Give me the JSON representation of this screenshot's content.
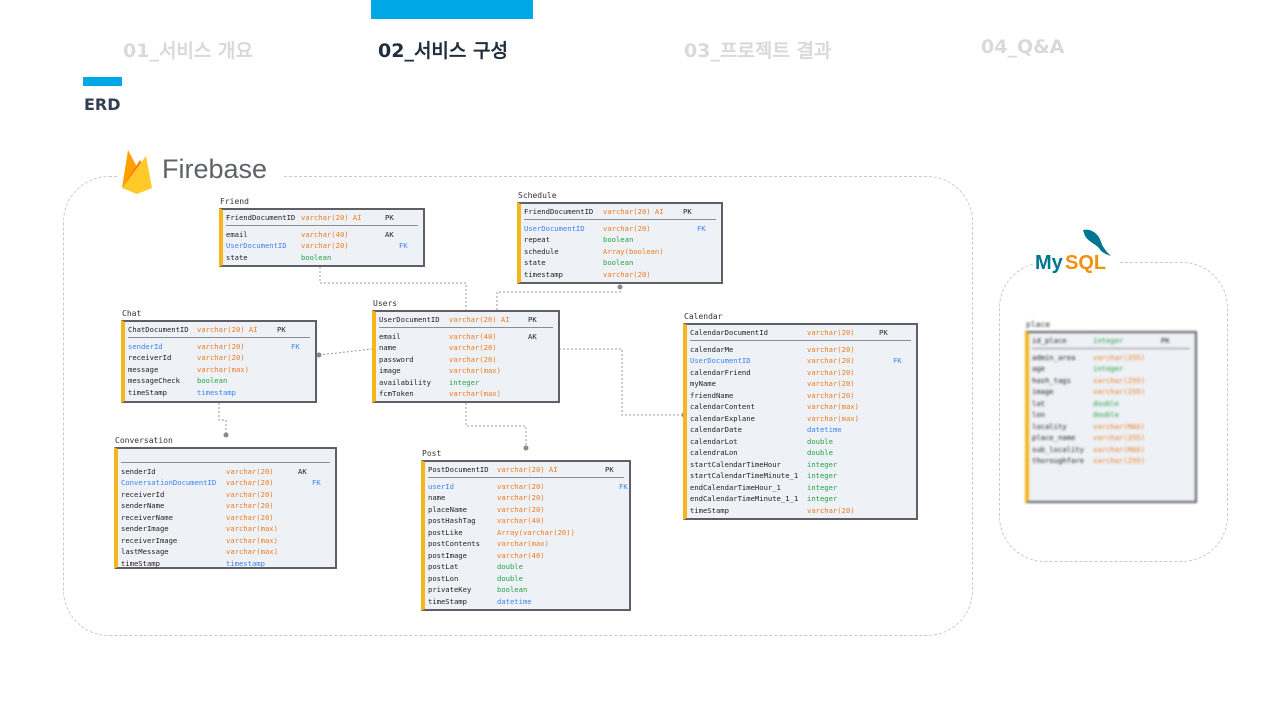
{
  "nav": {
    "tabs": [
      {
        "label": "01_서비스 개요",
        "active": false
      },
      {
        "label": "02_서비스 구성",
        "active": true
      },
      {
        "label": "03_프로젝트 결과",
        "active": false
      },
      {
        "label": "04_Q&A",
        "active": false
      }
    ]
  },
  "section": {
    "title": "ERD"
  },
  "logos": {
    "firebase": "Firebase",
    "mysql_my": "My",
    "mysql_sql": "SQL"
  },
  "colors": {
    "accent": "#00a8e8",
    "table_stripe": "#f5b51c",
    "varchar": "#ec7c22",
    "numeric": "#22a346",
    "fk": "#3b82f6"
  },
  "tables": [
    {
      "id": "friend",
      "name": "Friend",
      "header": [
        {
          "col": "FriendDocumentID",
          "type": "varchar(20) AI",
          "key": "PK"
        }
      ],
      "rows": [
        {
          "col": "email",
          "type": "varchar(40)",
          "key": "AK"
        },
        {
          "col": "UserDocumentID",
          "type": "varchar(20)",
          "key": "FK"
        },
        {
          "col": "state",
          "type": "boolean",
          "key": ""
        }
      ]
    },
    {
      "id": "schedule",
      "name": "Schedule",
      "header": [
        {
          "col": "FriendDocumentID",
          "type": "varchar(20) AI",
          "key": "PK"
        }
      ],
      "rows": [
        {
          "col": "UserDocumentID",
          "type": "varchar(20)",
          "key": "FK"
        },
        {
          "col": "repeat",
          "type": "boolean",
          "key": ""
        },
        {
          "col": "schedule",
          "type": "Array(boolean)",
          "key": ""
        },
        {
          "col": "state",
          "type": "boolean",
          "key": ""
        },
        {
          "col": "timestamp",
          "type": "varchar(20)",
          "key": ""
        }
      ]
    },
    {
      "id": "chat",
      "name": "Chat",
      "header": [
        {
          "col": "ChatDocumentID",
          "type": "varchar(20) AI",
          "key": "PK"
        }
      ],
      "rows": [
        {
          "col": "senderId",
          "type": "varchar(20)",
          "key": "FK"
        },
        {
          "col": "receiverId",
          "type": "varchar(20)",
          "key": ""
        },
        {
          "col": "message",
          "type": "varchar(max)",
          "key": ""
        },
        {
          "col": "messageCheck",
          "type": "boolean",
          "key": ""
        },
        {
          "col": "timeStamp",
          "type": "timestamp",
          "key": ""
        }
      ]
    },
    {
      "id": "users",
      "name": "Users",
      "header": [
        {
          "col": "UserDocumentID",
          "type": "varchar(20) AI",
          "key": "PK"
        }
      ],
      "rows": [
        {
          "col": "email",
          "type": "varchar(40)",
          "key": "AK"
        },
        {
          "col": "name",
          "type": "varchar(20)",
          "key": ""
        },
        {
          "col": "password",
          "type": "varchar(20)",
          "key": ""
        },
        {
          "col": "image",
          "type": "varchar(max)",
          "key": ""
        },
        {
          "col": "availability",
          "type": "integer",
          "key": ""
        },
        {
          "col": "fcmToken",
          "type": "varchar(max)",
          "key": ""
        }
      ]
    },
    {
      "id": "calendar",
      "name": "Calendar",
      "header": [
        {
          "col": "CalendarDocumentId",
          "type": "varchar(20)",
          "key": "PK"
        }
      ],
      "rows": [
        {
          "col": "calendarMe",
          "type": "varchar(20)",
          "key": ""
        },
        {
          "col": "UserDocumentID",
          "type": "varchar(20)",
          "key": "FK"
        },
        {
          "col": "calendarFriend",
          "type": "varchar(20)",
          "key": ""
        },
        {
          "col": "myName",
          "type": "varchar(20)",
          "key": ""
        },
        {
          "col": "friendName",
          "type": "varchar(20)",
          "key": ""
        },
        {
          "col": "calendarContent",
          "type": "varchar(max)",
          "key": ""
        },
        {
          "col": "calendarExplane",
          "type": "varchar(max)",
          "key": ""
        },
        {
          "col": "calendarDate",
          "type": "datetime",
          "key": ""
        },
        {
          "col": "calendarLot",
          "type": "double",
          "key": ""
        },
        {
          "col": "calendraLon",
          "type": "double",
          "key": ""
        },
        {
          "col": "startCalendarTimeHour",
          "type": "integer",
          "key": ""
        },
        {
          "col": "startCalendarTimeMinute_1",
          "type": "integer",
          "key": ""
        },
        {
          "col": "endCalendarTimeHour_1",
          "type": "integer",
          "key": ""
        },
        {
          "col": "endCalendarTimeMinute_1_1",
          "type": "integer",
          "key": ""
        },
        {
          "col": "timeStamp",
          "type": "varchar(20)",
          "key": ""
        }
      ]
    },
    {
      "id": "conversation",
      "name": "Conversation",
      "header": [],
      "rows": [
        {
          "col": "senderId",
          "type": "varchar(20)",
          "key": "AK"
        },
        {
          "col": "ConversationDocumentID",
          "type": "varchar(20)",
          "key": "FK"
        },
        {
          "col": "receiverId",
          "type": "varchar(20)",
          "key": ""
        },
        {
          "col": "senderName",
          "type": "varchar(20)",
          "key": ""
        },
        {
          "col": "receiverName",
          "type": "varchar(20)",
          "key": ""
        },
        {
          "col": "senderImage",
          "type": "varchar(max)",
          "key": ""
        },
        {
          "col": "receiverImage",
          "type": "varchar(max)",
          "key": ""
        },
        {
          "col": "lastMessage",
          "type": "varchar(max)",
          "key": ""
        },
        {
          "col": "timeStamp",
          "type": "timestamp",
          "key": ""
        }
      ]
    },
    {
      "id": "post",
      "name": "Post",
      "header": [
        {
          "col": "PostDocumentID",
          "type": "varchar(20) AI",
          "key": "PK"
        }
      ],
      "rows": [
        {
          "col": "userId",
          "type": "varchar(20)",
          "key": "FK"
        },
        {
          "col": "name",
          "type": "varchar(20)",
          "key": ""
        },
        {
          "col": "placeName",
          "type": "varchar(20)",
          "key": ""
        },
        {
          "col": "postHashTag",
          "type": "varchar(40)",
          "key": ""
        },
        {
          "col": "postLike",
          "type": "Array(varchar(20))",
          "key": ""
        },
        {
          "col": "postContents",
          "type": "varchar(max)",
          "key": ""
        },
        {
          "col": "postImage",
          "type": "varchar(40)",
          "key": ""
        },
        {
          "col": "postLat",
          "type": "double",
          "key": ""
        },
        {
          "col": "postLon",
          "type": "double",
          "key": ""
        },
        {
          "col": "privateKey",
          "type": "boolean",
          "key": ""
        },
        {
          "col": "timeStamp",
          "type": "datetime",
          "key": ""
        }
      ]
    },
    {
      "id": "place",
      "name": "place",
      "header": [
        {
          "col": "id_place",
          "type": "integer",
          "key": "PK"
        }
      ],
      "rows": [
        {
          "col": "admin_area",
          "type": "varchar(255)",
          "key": ""
        },
        {
          "col": "age",
          "type": "integer",
          "key": ""
        },
        {
          "col": "hash_tags",
          "type": "varchar(255)",
          "key": ""
        },
        {
          "col": "image",
          "type": "varchar(255)",
          "key": ""
        },
        {
          "col": "lat",
          "type": "double",
          "key": ""
        },
        {
          "col": "lon",
          "type": "double",
          "key": ""
        },
        {
          "col": "locality",
          "type": "varchar(MAX)",
          "key": ""
        },
        {
          "col": "place_name",
          "type": "varchar(255)",
          "key": ""
        },
        {
          "col": "sub_locality",
          "type": "varchar(MAX)",
          "key": ""
        },
        {
          "col": "thoroughfare",
          "type": "varchar(255)",
          "key": ""
        }
      ]
    }
  ]
}
